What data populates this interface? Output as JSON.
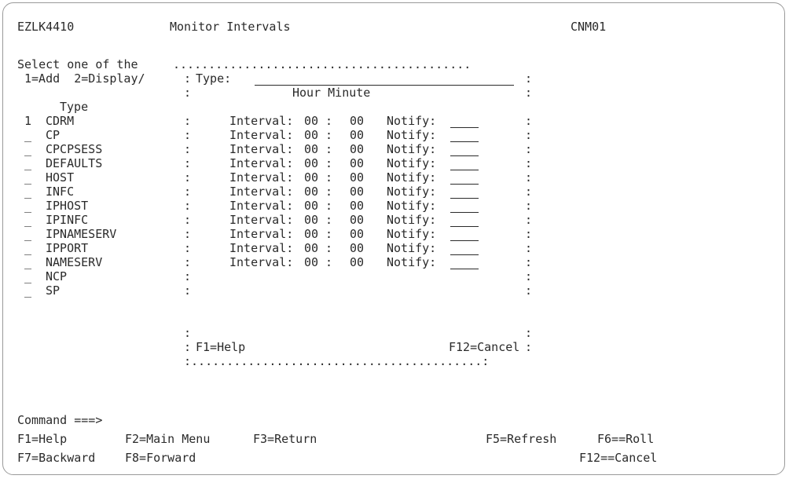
{
  "header": {
    "panel_id": "EZLK4410",
    "title": "Monitor Intervals",
    "domain": "CNM01"
  },
  "list": {
    "instruction": "Select one of the",
    "actions": "1=Add  2=Display/",
    "type_header": "Type",
    "items": [
      {
        "sel": "1",
        "type": "CDRM"
      },
      {
        "sel": "_",
        "type": "CP"
      },
      {
        "sel": "_",
        "type": "CPCPSESS"
      },
      {
        "sel": "_",
        "type": "DEFAULTS"
      },
      {
        "sel": "_",
        "type": "HOST"
      },
      {
        "sel": "_",
        "type": "INFC"
      },
      {
        "sel": "_",
        "type": "IPHOST"
      },
      {
        "sel": "_",
        "type": "IPINFC"
      },
      {
        "sel": "_",
        "type": "IPNAMESERV"
      },
      {
        "sel": "_",
        "type": "IPPORT"
      },
      {
        "sel": "_",
        "type": "NAMESERV"
      },
      {
        "sel": "_",
        "type": "NCP"
      },
      {
        "sel": "_",
        "type": "SP"
      }
    ]
  },
  "popup": {
    "top_border": "..........................................",
    "bottom_border": ":.........................................:",
    "side": ":",
    "type_label": "Type:",
    "type_value": "",
    "column_headers": "Hour Minute",
    "interval_label": "Interval:",
    "interval_sep": ":",
    "notify_label": "Notify:",
    "rows": [
      {
        "hour": "00",
        "minute": "00",
        "notify": ""
      },
      {
        "hour": "00",
        "minute": "00",
        "notify": ""
      },
      {
        "hour": "00",
        "minute": "00",
        "notify": ""
      },
      {
        "hour": "00",
        "minute": "00",
        "notify": ""
      },
      {
        "hour": "00",
        "minute": "00",
        "notify": ""
      },
      {
        "hour": "00",
        "minute": "00",
        "notify": ""
      },
      {
        "hour": "00",
        "minute": "00",
        "notify": ""
      },
      {
        "hour": "00",
        "minute": "00",
        "notify": ""
      },
      {
        "hour": "00",
        "minute": "00",
        "notify": ""
      },
      {
        "hour": "00",
        "minute": "00",
        "notify": ""
      },
      {
        "hour": "00",
        "minute": "00",
        "notify": ""
      }
    ],
    "f1": "F1=Help",
    "f12": "F12=Cancel"
  },
  "command": {
    "label": "Command ===>",
    "value": ""
  },
  "function_keys": {
    "f1": "F1=Help",
    "f2": "F2=Main Menu",
    "f3": "F3=Return",
    "f5": "F5=Refresh",
    "f6": "F6==Roll",
    "f7": "F7=Backward",
    "f8": "F8=Forward",
    "f12": "F12==Cancel"
  }
}
